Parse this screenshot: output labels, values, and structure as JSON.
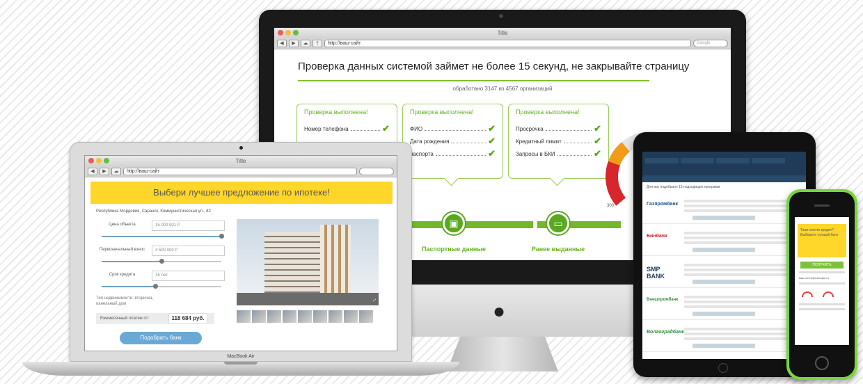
{
  "imac": {
    "window_title": "Title",
    "url": "http://ваш-сайт",
    "search_placeholder": "Google",
    "headline": "Проверка данных системой займет не более 15 секунд, не закрывайте страницу",
    "progress_text": "обработано 3147 из 4567 организаций",
    "cards": [
      {
        "title": "Проверка выполнена!",
        "rows": [
          "Номер телефона",
          "",
          ""
        ]
      },
      {
        "title": "Проверка выполнена!",
        "rows": [
          "ФИО",
          "Дата рождения",
          "паспорта"
        ]
      },
      {
        "title": "Проверка выполнена!",
        "rows": [
          "Просрочка",
          "Кредитный лимит",
          "Запросы в БКИ"
        ]
      }
    ],
    "steps": [
      {
        "label": "Паспортные данные",
        "icon": "passport-icon"
      },
      {
        "label": "Ранее выданные",
        "icon": "card-icon"
      }
    ],
    "gauge": {
      "labels": [
        "300",
        "580",
        "640"
      ]
    },
    "apple_icon": "apple-logo-icon"
  },
  "macbook": {
    "window_title": "Title",
    "url": "http://ваш-сайт",
    "brand": "MacBook Air",
    "banner": "Выбери лучшее предложение по ипотеке!",
    "address": "Республика Мордовия, Саранск, Коммунистическая ул., 82",
    "fields": [
      {
        "label": "Цена объекта",
        "value": "15 000 001 Р",
        "level": 1.0
      },
      {
        "label": "Первоначальный взнос",
        "value": "4 500 000 Р",
        "level": 0.5
      },
      {
        "label": "Срок кредита",
        "value": "15 лет",
        "level": 0.45
      }
    ],
    "property_type": "Тип недвижимости: вторичка, панельный дом",
    "payment_label": "Ежемесячный платеж от:",
    "payment_value": "118 684 руб.",
    "submit": "Подобрать банк"
  },
  "tablet": {
    "subtitle": "Для вас подобрано 15 подходящих программ",
    "banks": [
      "Газпромбанк",
      "Бинбанк",
      "SMP BANK",
      "Внешпромбанк",
      "Волгоградбанк"
    ]
  },
  "phone": {
    "banner": "Тоже хотите кредит? Выберите лучший банк",
    "button": "ПОЛУЧИТЬ",
    "email": "ваш.почта@example.ru"
  }
}
